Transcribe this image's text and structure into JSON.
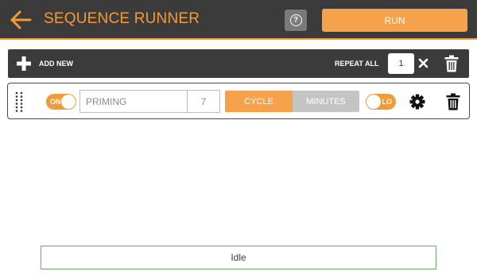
{
  "header": {
    "title": "SEQUENCE RUNNER",
    "back_icon": "arrow-left-icon",
    "help_icon": "question-circle-icon",
    "help_glyph": "?",
    "run_label": "RUN"
  },
  "toolbar": {
    "add_icon": "plus-icon",
    "add_label": "ADD NEW",
    "repeat_label": "REPEAT ALL",
    "repeat_value": "1",
    "clear_icon": "x-icon",
    "delete_icon": "trash-icon"
  },
  "sequence": {
    "rows": [
      {
        "enabled_label": "ON",
        "name": "PRIMING",
        "count": "7",
        "mode_options": [
          "CYCLE",
          "MINUTES"
        ],
        "mode_selected": "CYCLE",
        "power_label": "LO",
        "settings_icon": "gear-icon",
        "delete_icon": "trash-icon",
        "drag_icon": "drag-handle-icon"
      }
    ]
  },
  "status": {
    "text": "Idle"
  },
  "colors": {
    "accent": "#f39a38",
    "bar": "#3b3b3b",
    "inactive": "#c4c4c4",
    "status_border": "#6aa56a"
  }
}
